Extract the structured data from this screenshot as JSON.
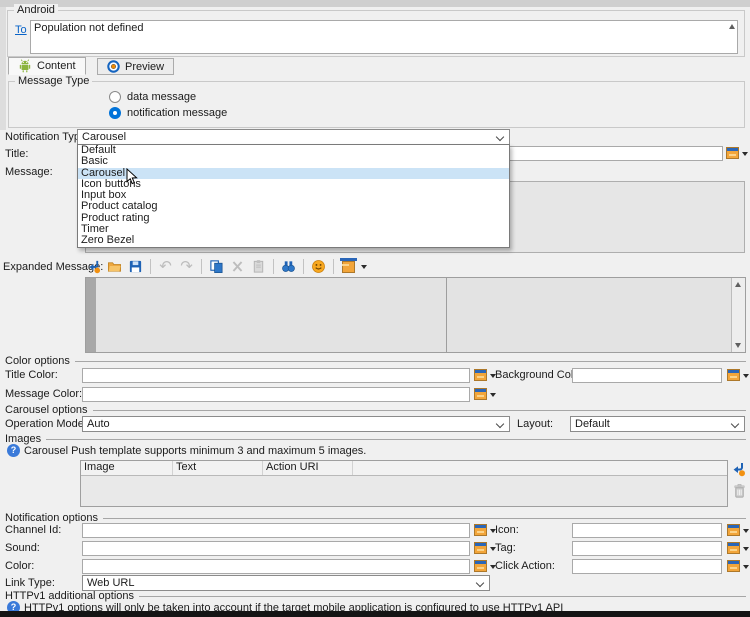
{
  "ui": {
    "android_group": {
      "title": "Android",
      "to_link": "To",
      "to_value": "Population not defined"
    },
    "tabs": {
      "content": "Content",
      "preview": "Preview"
    },
    "message_type": {
      "title": "Message Type",
      "data_message": "data message",
      "notification_message": "notification message",
      "selected": "notification message"
    },
    "notification_type": {
      "label": "Notification Type:",
      "value": "Carousel",
      "options": [
        "Default",
        "Basic",
        "Carousel",
        "Icon buttons",
        "Input box",
        "Product catalog",
        "Product rating",
        "Timer",
        "Zero Bezel"
      ],
      "highlighted_option": "Carousel"
    },
    "title_field": {
      "label": "Title:",
      "value": ""
    },
    "message_field": {
      "label": "Message:",
      "value": ""
    },
    "expanded_message": {
      "label": "Expanded Message:",
      "value": ""
    },
    "color_options": {
      "header": "Color options",
      "title_color_label": "Title Color:",
      "title_color_value": "",
      "background_color_label": "Background Color:",
      "background_color_value": "",
      "message_color_label": "Message Color:",
      "message_color_value": ""
    },
    "carousel_options": {
      "header": "Carousel options",
      "operation_mode_label": "Operation Mode:",
      "operation_mode_value": "Auto",
      "layout_label": "Layout:",
      "layout_value": "Default"
    },
    "images": {
      "header": "Images",
      "info": "Carousel Push template supports minimum 3 and maximum 5 images.",
      "columns": [
        "Image",
        "Text",
        "Action URI"
      ],
      "rows": []
    },
    "notification_options": {
      "header": "Notification options",
      "channel_id_label": "Channel Id:",
      "channel_id_value": "",
      "icon_label": "Icon:",
      "icon_value": "",
      "sound_label": "Sound:",
      "sound_value": "",
      "tag_label": "Tag:",
      "tag_value": "",
      "color_label": "Color:",
      "color_value": "",
      "click_action_label": "Click Action:",
      "click_action_value": "",
      "link_type_label": "Link Type:",
      "link_type_value": "Web URL"
    },
    "httpv1": {
      "header": "HTTPv1 additional options",
      "info": "HTTPv1 options will only be taken into account if the target mobile application is configured to use HTTPv1 API"
    },
    "icons": {
      "tab_content": "android-icon",
      "tab_preview": "eye-icon",
      "toolbar": [
        "import-file-icon",
        "open-folder-icon",
        "save-icon",
        "undo-icon",
        "redo-icon",
        "copy-icon",
        "cut-icon",
        "paste-icon",
        "find-icon",
        "emoji-icon",
        "insert-field-icon"
      ],
      "field_picker": "field-picker-icon",
      "images_actions": [
        "add-row-icon",
        "delete-row-icon"
      ],
      "info": "info-icon"
    },
    "colors": {
      "accent_blue": "#0173d9",
      "highlight_blue": "#cbe3f6",
      "icon_blue": "#1e62b5",
      "icon_orange": "#f2a53a",
      "link_blue": "#0a64c8"
    }
  }
}
